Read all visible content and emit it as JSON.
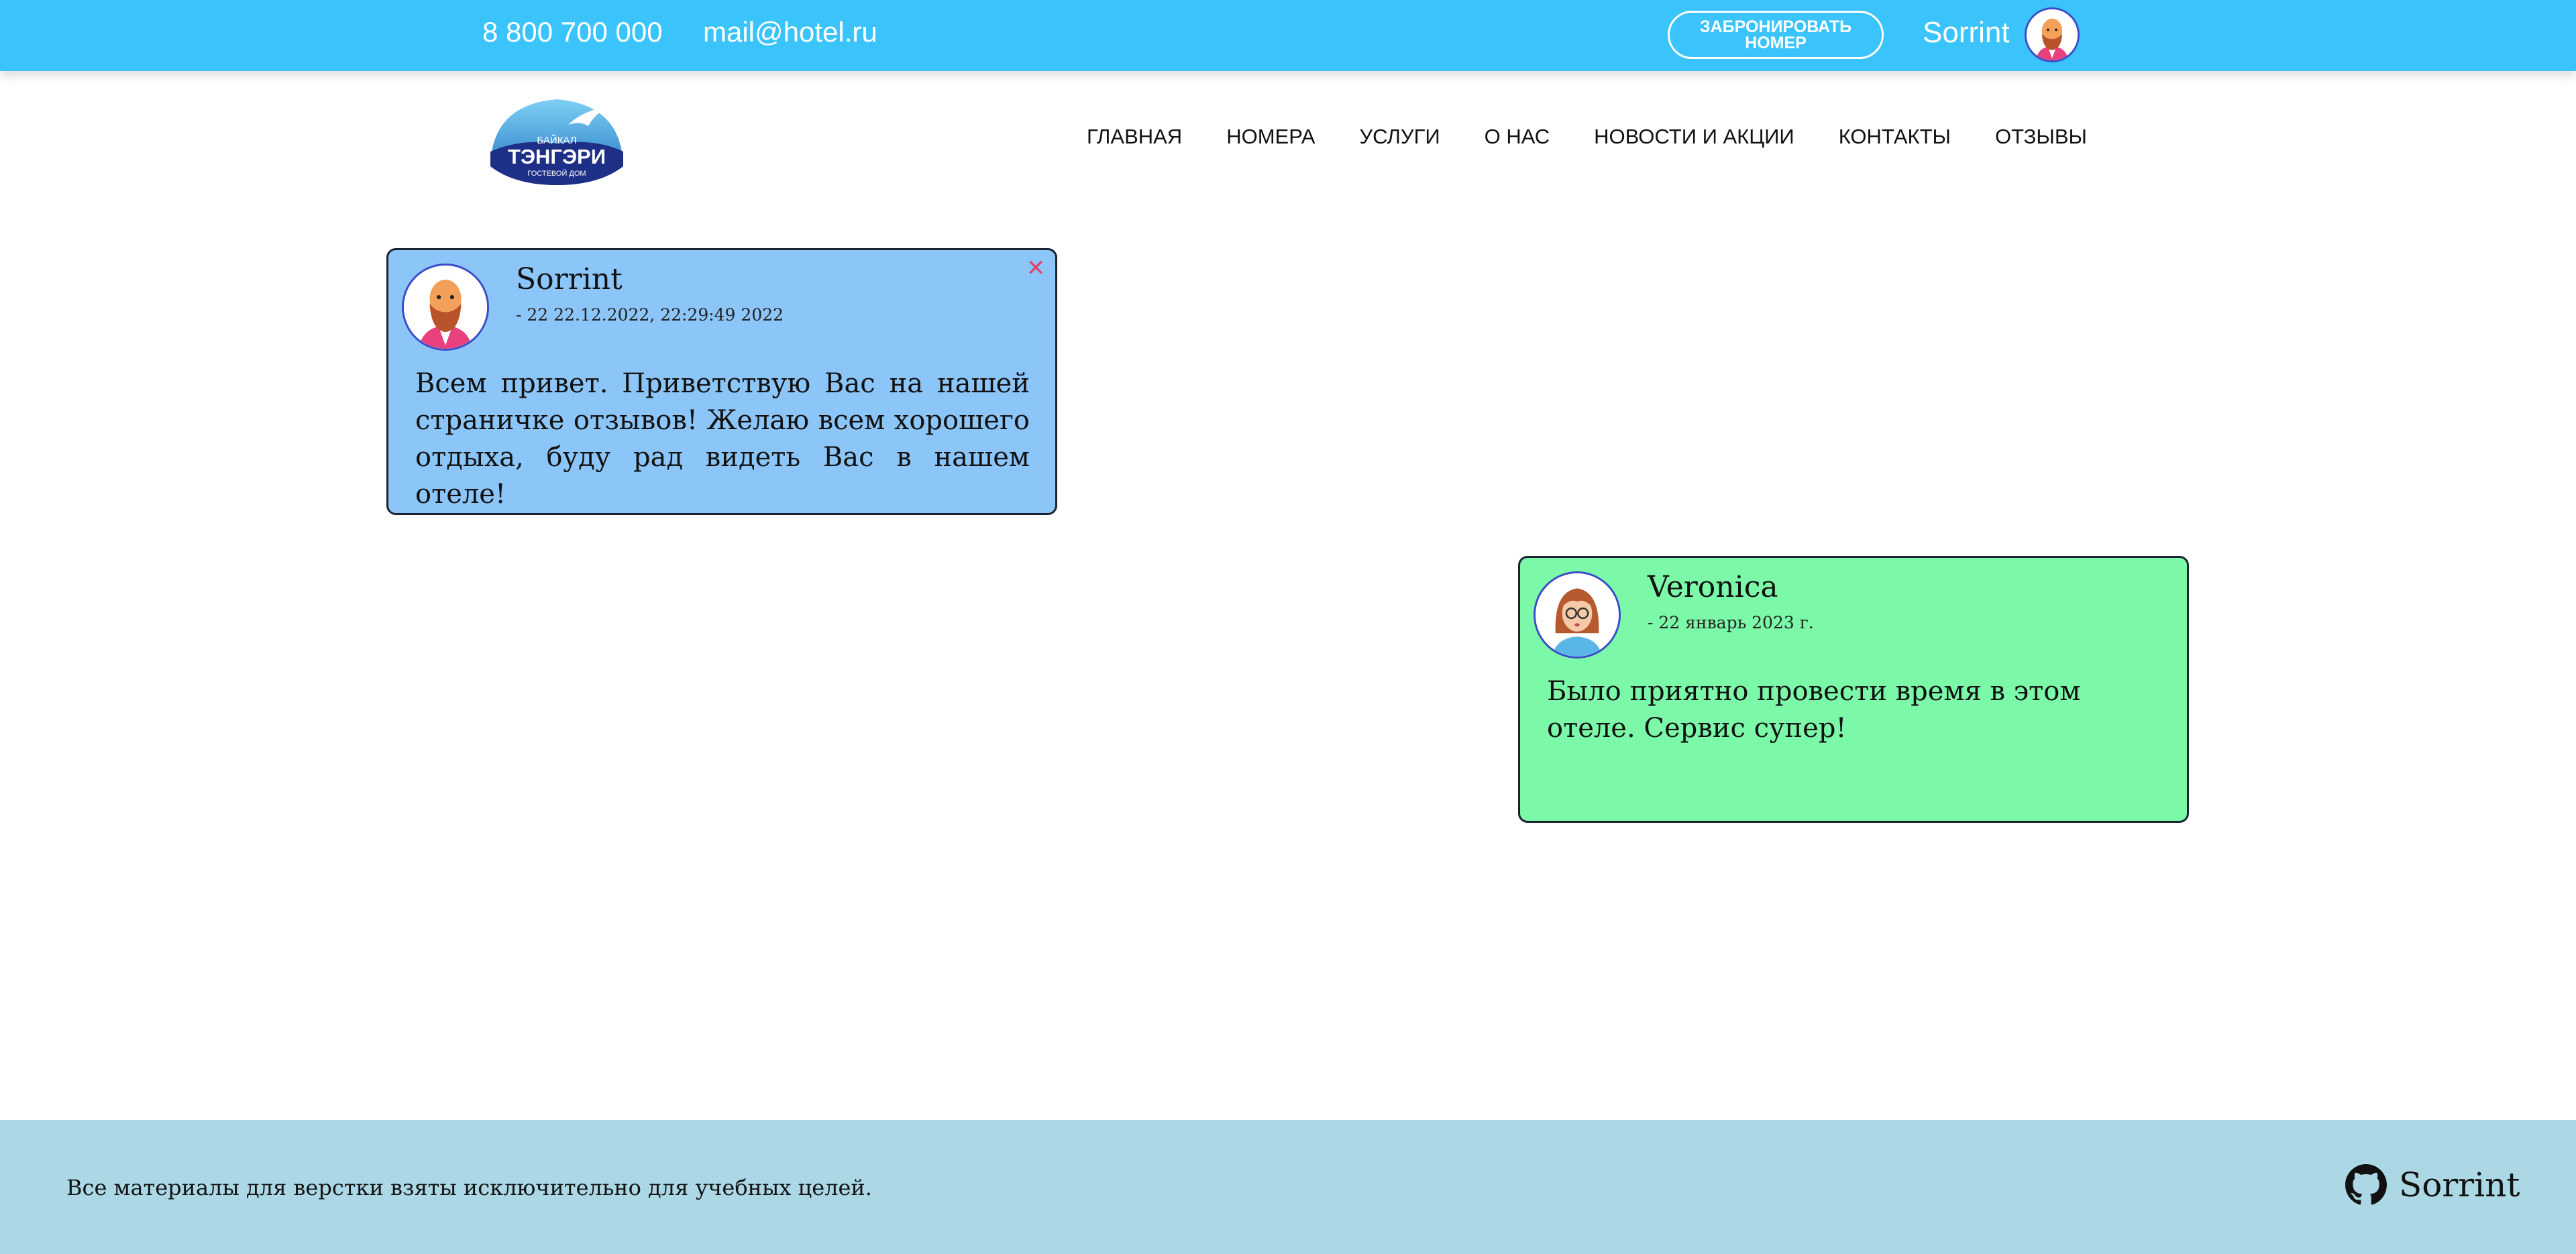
{
  "topbar": {
    "phone": "8 800 700 000",
    "email": "mail@hotel.ru",
    "book_button": "ЗАБРОНИРОВАТЬ НОМЕР",
    "user_name": "Sorrint",
    "background": "#3bc4fb"
  },
  "logo": {
    "line1": "БАЙКАЛ",
    "line2": "ТЭНГЭРИ",
    "line3": "ГОСТЕВОЙ ДОМ"
  },
  "nav": {
    "items": [
      "ГЛАВНАЯ",
      "НОМЕРА",
      "УСЛУГИ",
      "О НАС",
      "НОВОСТИ И АКЦИИ",
      "КОНТАКТЫ",
      "ОТЗЫВЫ"
    ]
  },
  "reviews": [
    {
      "author": "Sorrint",
      "date": "- 22 22.12.2022, 22:29:49 2022",
      "text": "Всем привет. Приветствую Вас на нашей страничке отзывов! Желаю всем хорошего отдыха, буду рад видеть Вас в нашем отеле!",
      "close_icon": "close-icon",
      "color": "#8cc5f8"
    },
    {
      "author": "Veronica",
      "date": "- 22 январь 2023 г.",
      "text": "Было приятно провести время в этом отеле. Сервис супер!",
      "color": "#7bf9a8"
    }
  ],
  "footer": {
    "note": "Все материалы для верстки взяты исключительно для учебных целей.",
    "github_icon": "github-icon",
    "github_name": "Sorrint",
    "background": "#acd8e6"
  }
}
